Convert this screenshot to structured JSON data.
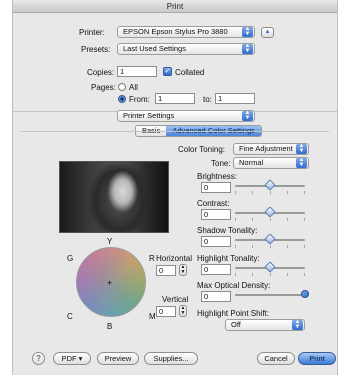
{
  "window": {
    "title": "Print"
  },
  "printer": {
    "label": "Printer:",
    "value": "EPSON Epson Stylus Pro 3880",
    "expand_glyph": "▲"
  },
  "presets": {
    "label": "Presets:",
    "value": "Last Used Settings"
  },
  "copies": {
    "label": "Copies:",
    "value": "1",
    "collated_label": "Collated",
    "collated_checked": true
  },
  "pages": {
    "label": "Pages:",
    "all_label": "All",
    "from_label": "From:",
    "from_value": "1",
    "to_label": "to:",
    "to_value": "1",
    "selected": "From"
  },
  "section": {
    "value": "Printer Settings"
  },
  "tabs": [
    {
      "label": "Basic",
      "selected": false
    },
    {
      "label": "Advanced Color Settings",
      "selected": true
    }
  ],
  "color_toning": {
    "label": "Color Toning:",
    "value": "Fine Adjustment"
  },
  "tone": {
    "label": "Tone:",
    "value": "Normal"
  },
  "brightness": {
    "label": "Brightness:",
    "value": "0",
    "level": 0.5
  },
  "contrast": {
    "label": "Contrast:",
    "value": "0",
    "level": 0.5
  },
  "shadow_tonality": {
    "label": "Shadow Tonality:",
    "value": "0",
    "level": 0.5
  },
  "highlight_tonality": {
    "label": "Highlight Tonality:",
    "value": "0",
    "level": 0.5
  },
  "max_optical_density": {
    "label": "Max Optical Density:",
    "value": "0",
    "level": 1.0
  },
  "highlight_point_shift": {
    "label": "Highlight Point Shift:",
    "value": "Off"
  },
  "color_wheel": {
    "labels": {
      "top": "Y",
      "left_top": "G",
      "right_top": "R",
      "left_bottom": "C",
      "right_bottom": "M",
      "bottom": "B",
      "center": "+"
    },
    "horizontal_label": "Horizontal",
    "horizontal_value": "0",
    "vertical_label": "Vertical",
    "vertical_value": "0"
  },
  "footer": {
    "help": "?",
    "pdf_label": "PDF ▾",
    "preview_label": "Preview",
    "supplies_label": "Supplies...",
    "cancel_label": "Cancel",
    "print_label": "Print"
  },
  "colors": {
    "accent": "#2f6bd6"
  }
}
